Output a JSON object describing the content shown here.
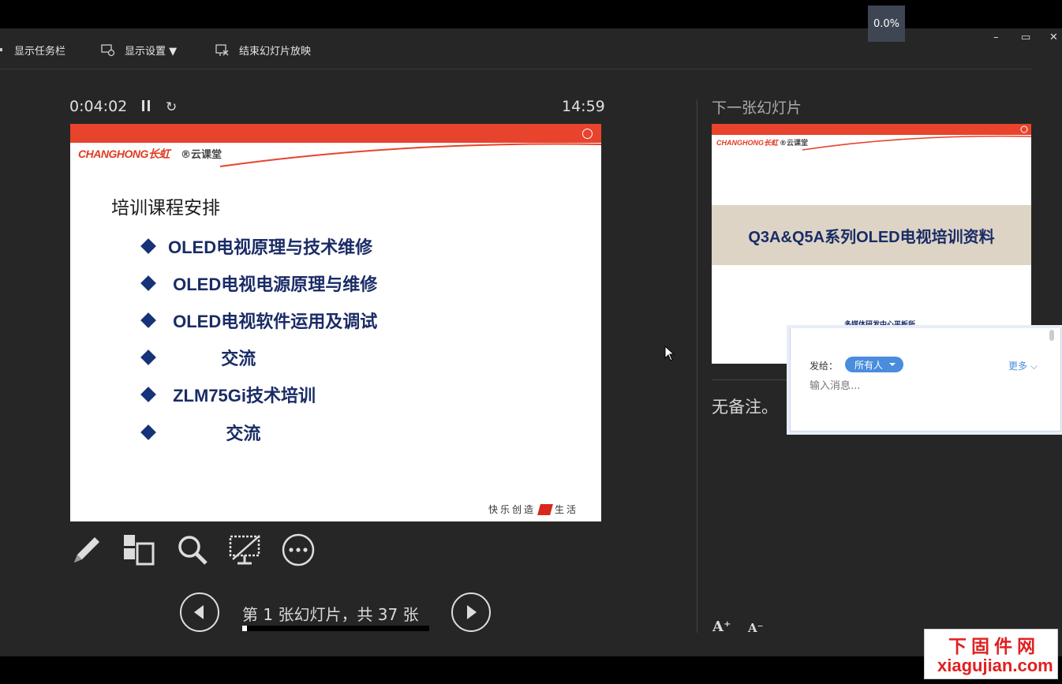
{
  "percent_badge": "0.0%",
  "toolbar": {
    "show_taskbar": "显示任务栏",
    "display_settings": "显示设置 ▼",
    "end_slideshow": "结束幻灯片放映"
  },
  "window_controls": {
    "minimize": "–",
    "restore": "▭",
    "close": "✕"
  },
  "presenter": {
    "elapsed": "0:04:02",
    "clock": "14:59",
    "slide_counter": "第 1 张幻灯片，共 37 张",
    "progress": 0.027,
    "next_label": "下一张幻灯片",
    "notes": "无备注。"
  },
  "current_slide": {
    "logo": "CHANGHONG长虹",
    "logo_sub": "®云课堂",
    "title": "培训课程安排",
    "bullets": [
      "OLED电视原理与技术维修",
      " OLED电视电源原理与维修",
      " OLED电视软件运用及调试",
      "           交流",
      " ZLM75Gi技术培训",
      "            交流"
    ],
    "footer_left": "快乐创造",
    "footer_right": "生活"
  },
  "next_slide": {
    "logo": "CHANGHONG长虹",
    "logo_sub": "®云课堂",
    "title": "Q3A&Q5A系列OLED电视培训资料",
    "subtitle": "多媒体研发中心平板所"
  },
  "chat": {
    "to_label": "发给：",
    "recipient": "所有人",
    "more": "更多 ⌵",
    "input_placeholder": "输入消息..."
  },
  "font_buttons": {
    "increase": "A⁺",
    "decrease": "A⁻"
  },
  "watermark": {
    "line1": "下固件网",
    "line2": "xiagujian.com"
  },
  "icons": [
    "pen-icon",
    "slide-grid-icon",
    "zoom-icon",
    "screen-off-icon",
    "more-icon",
    "prev-icon",
    "next-icon",
    "pause-icon",
    "reset-icon"
  ]
}
